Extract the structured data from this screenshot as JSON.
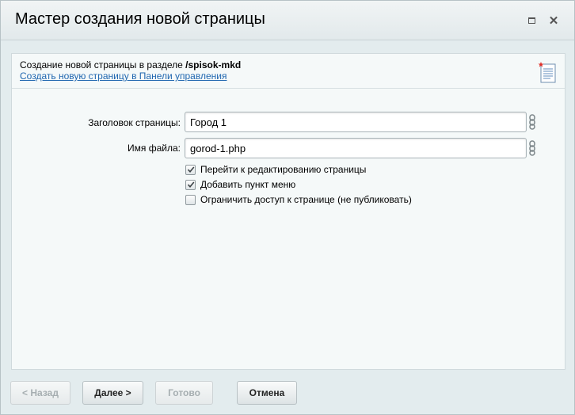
{
  "window": {
    "title": "Мастер создания новой страницы",
    "maximize_icon": "maximize-icon",
    "close_icon": "close-icon"
  },
  "header": {
    "section_prefix": "Создание новой страницы в разделе ",
    "section_path": "/spisok-mkd",
    "control_panel_link": "Создать новую страницу в Панели управления",
    "icon": "new-document-icon"
  },
  "form": {
    "page_title_label": "Заголовок страницы:",
    "page_title_value": "Город 1",
    "file_name_label": "Имя файла:",
    "file_name_value": "gorod-1.php",
    "link_icon": "chain-link-icon"
  },
  "options": [
    {
      "label": "Перейти к редактированию страницы",
      "checked": true
    },
    {
      "label": "Добавить пункт меню",
      "checked": true
    },
    {
      "label": "Ограничить доступ к странице (не публиковать)",
      "checked": false
    }
  ],
  "buttons": {
    "back": "< Назад",
    "next": "Далее >",
    "done": "Готово",
    "cancel": "Отмена"
  },
  "colors": {
    "link": "#2067b0",
    "dialog_bg": "#e3ecee",
    "content_bg": "#f5f9f9"
  }
}
